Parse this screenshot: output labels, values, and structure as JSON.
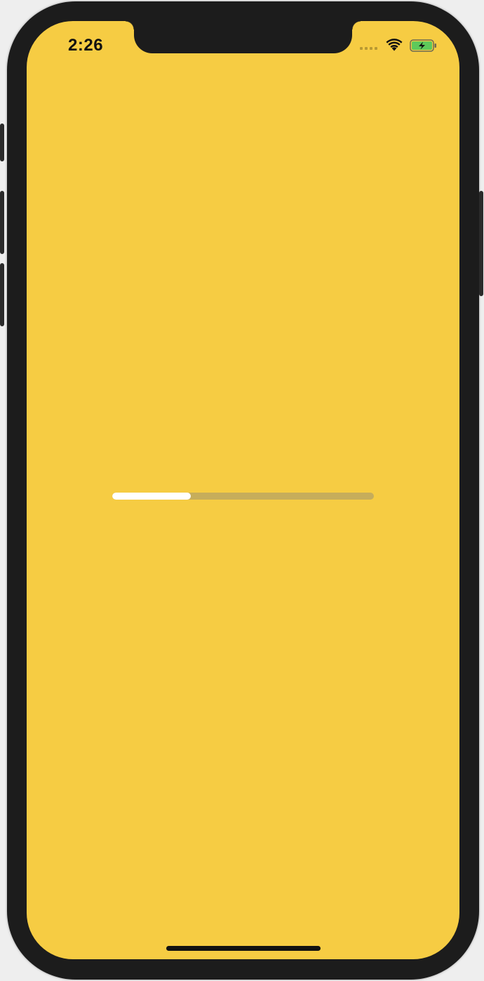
{
  "status_bar": {
    "time": "2:26",
    "signal_icon": "cellular-signal-icon",
    "wifi_icon": "wifi-icon",
    "battery_icon": "battery-charging-icon"
  },
  "screen": {
    "background_color": "#f6cc43"
  },
  "progress": {
    "value": 0.3,
    "fill_color": "#ffffff",
    "track_color": "#c6ad5b"
  }
}
